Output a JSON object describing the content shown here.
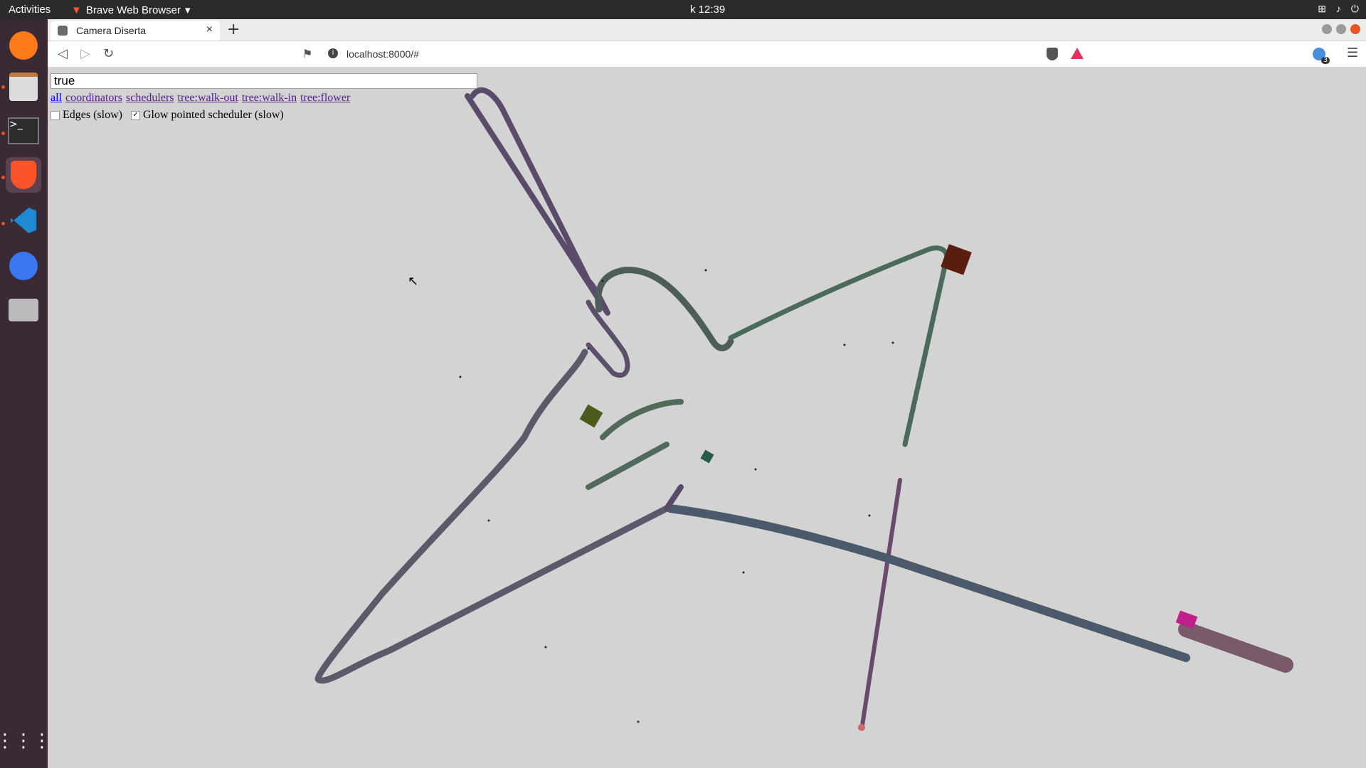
{
  "topbar": {
    "activities": "Activities",
    "app_name": "Brave Web Browser",
    "clock": "k 12:39"
  },
  "browser": {
    "tab_title": "Camera Diserta",
    "url": "localhost:8000/#",
    "extension_badge": "3"
  },
  "page": {
    "query_value": "true",
    "filters": [
      "all",
      "coordinators",
      "schedulers",
      "tree:walk-out",
      "tree:walk-in",
      "tree:flower"
    ],
    "options": [
      {
        "label": "Edges (slow)",
        "checked": false
      },
      {
        "label": "Glow pointed scheduler (slow)",
        "checked": true
      }
    ]
  },
  "colors": {
    "path_stroke": "#4a4a5a",
    "node_red": "#5a1e10",
    "node_green": "#4c5a1e",
    "node_teal": "#2a5a4a",
    "node_magenta": "#c0208a"
  }
}
